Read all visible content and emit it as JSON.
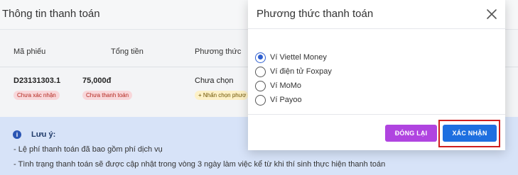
{
  "background": {
    "title": "Thông tin thanh toán",
    "columns": [
      "Mã phiếu",
      "Tổng tiền",
      "Phương thức"
    ],
    "row": {
      "code": "D23131303.1",
      "code_status": "Chưa xác nhận",
      "total": "75,000đ",
      "total_status": "Chưa thanh toán",
      "method": "Chưa chọn",
      "method_action": "+ Nhấn chọn phươ"
    },
    "note": {
      "title": "Lưu ý:",
      "lines": [
        "- Lệ phí thanh toán đã bao gồm phí dịch vụ",
        "- Tình trạng thanh toán sẽ được cập nhật trong vòng 3 ngày làm việc kể từ khi thí sinh thực hiện thanh toán"
      ]
    }
  },
  "modal": {
    "title": "Phương thức thanh toán",
    "options": [
      {
        "label": "Ví Viettel Money",
        "selected": true
      },
      {
        "label": "Ví điện tử Foxpay",
        "selected": false
      },
      {
        "label": "Ví MoMo",
        "selected": false
      },
      {
        "label": "Ví Payoo",
        "selected": false
      }
    ],
    "close_label": "ĐÓNG LẠI",
    "confirm_label": "XÁC NHẬN"
  },
  "colors": {
    "accent": "#2f5fcf",
    "close_button": "#b044e0",
    "confirm_button": "#1e6fe0",
    "highlight": "#cf1f1f"
  }
}
